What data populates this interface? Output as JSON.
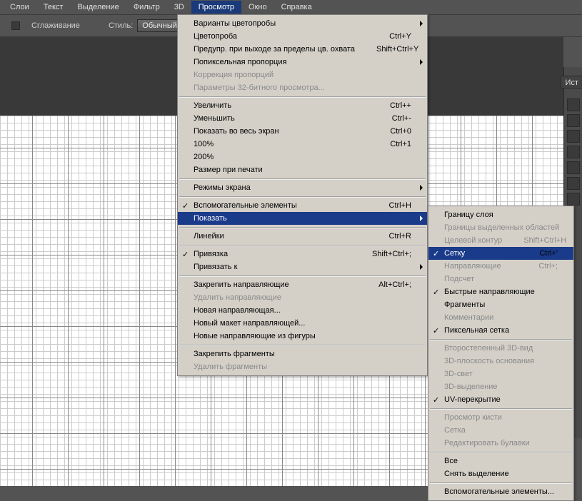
{
  "menubar": {
    "items": [
      "Слои",
      "Текст",
      "Выделение",
      "Фильтр",
      "3D",
      "Просмотр",
      "Окно",
      "Справка"
    ],
    "activeIndex": 5
  },
  "options": {
    "smoothing_label": "Сглаживание",
    "style_label": "Стиль:",
    "style_value": "Обычный"
  },
  "right_panel_tab": "Ист",
  "menu_view": [
    {
      "label": "Варианты цветопробы",
      "arrow": true
    },
    {
      "label": "Цветопроба",
      "shortcut": "Ctrl+Y"
    },
    {
      "label": "Предупр. при выходе за пределы цв. охвата",
      "shortcut": "Shift+Ctrl+Y"
    },
    {
      "label": "Попиксельная пропорция",
      "arrow": true
    },
    {
      "label": "Коррекция пропорций",
      "disabled": true
    },
    {
      "label": "Параметры 32-битного просмотра...",
      "disabled": true
    },
    {
      "sep": true
    },
    {
      "label": "Увеличить",
      "shortcut": "Ctrl++"
    },
    {
      "label": "Уменьшить",
      "shortcut": "Ctrl+-"
    },
    {
      "label": "Показать во весь экран",
      "shortcut": "Ctrl+0"
    },
    {
      "label": "100%",
      "shortcut": "Ctrl+1"
    },
    {
      "label": "200%"
    },
    {
      "label": "Размер при печати"
    },
    {
      "sep": true
    },
    {
      "label": "Режимы экрана",
      "arrow": true
    },
    {
      "sep": true
    },
    {
      "label": "Вспомогательные элементы",
      "shortcut": "Ctrl+H",
      "check": true
    },
    {
      "label": "Показать",
      "arrow": true,
      "highlight": true
    },
    {
      "sep": true
    },
    {
      "label": "Линейки",
      "shortcut": "Ctrl+R"
    },
    {
      "sep": true
    },
    {
      "label": "Привязка",
      "shortcut": "Shift+Ctrl+;",
      "check": true
    },
    {
      "label": "Привязать к",
      "arrow": true
    },
    {
      "sep": true
    },
    {
      "label": "Закрепить направляющие",
      "shortcut": "Alt+Ctrl+;"
    },
    {
      "label": "Удалить направляющие",
      "disabled": true
    },
    {
      "label": "Новая направляющая..."
    },
    {
      "label": "Новый макет направляющей..."
    },
    {
      "label": "Новые направляющие из фигуры"
    },
    {
      "sep": true
    },
    {
      "label": "Закрепить фрагменты"
    },
    {
      "label": "Удалить фрагменты",
      "disabled": true
    }
  ],
  "menu_show": [
    {
      "label": "Границу слоя"
    },
    {
      "label": "Границы выделенных областей",
      "disabled": true
    },
    {
      "label": "Целевой контур",
      "shortcut": "Shift+Ctrl+H",
      "disabled": true
    },
    {
      "label": "Сетку",
      "shortcut": "Ctrl+'",
      "check": true,
      "highlight": true
    },
    {
      "label": "Направляющие",
      "shortcut": "Ctrl+;",
      "disabled": true
    },
    {
      "label": "Подсчет",
      "disabled": true
    },
    {
      "label": "Быстрые направляющие",
      "check": true
    },
    {
      "label": "Фрагменты"
    },
    {
      "label": "Комментарии",
      "disabled": true
    },
    {
      "label": "Пиксельная сетка",
      "check": true
    },
    {
      "sep": true
    },
    {
      "label": "Второстепенный 3D-вид",
      "disabled": true
    },
    {
      "label": "3D-плоскость основания",
      "disabled": true
    },
    {
      "label": "3D-свет",
      "disabled": true
    },
    {
      "label": "3D-выделение",
      "disabled": true
    },
    {
      "label": "UV-перекрытие",
      "check": true
    },
    {
      "sep": true
    },
    {
      "label": "Просмотр кисти",
      "disabled": true
    },
    {
      "label": "Сетка",
      "disabled": true
    },
    {
      "label": "Редактировать булавки",
      "disabled": true
    },
    {
      "sep": true
    },
    {
      "label": "Все"
    },
    {
      "label": "Снять выделение"
    },
    {
      "sep": true
    },
    {
      "label": "Вспомогательные элементы..."
    }
  ]
}
